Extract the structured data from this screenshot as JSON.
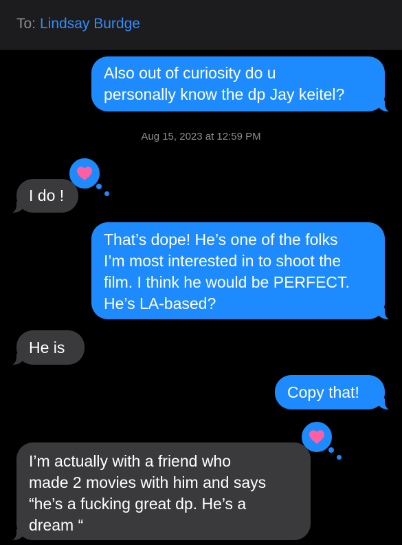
{
  "header": {
    "to_label": "To:",
    "recipient": "Lindsay Burdge"
  },
  "thread": {
    "messages": [
      {
        "direction": "sent",
        "text": "Also out of curiosity do u\npersonally know the dp Jay keitel?"
      },
      {
        "direction": "received",
        "text": "I do !",
        "reaction": "heart"
      },
      {
        "direction": "sent",
        "text": "That’s dope! He’s one of the folks\nI’m most interested in to shoot the\nfilm. I think he would be PERFECT.\nHe’s LA-based?"
      },
      {
        "direction": "received",
        "text": "He is"
      },
      {
        "direction": "sent",
        "text": "Copy that!"
      },
      {
        "direction": "received",
        "text": "I’m actually with a friend who\nmade 2 movies with him and  says\n“he’s a fucking great dp. He’s a\ndream “",
        "reaction": "heart"
      }
    ],
    "timestamp": "Aug 15, 2023 at 12:59 PM"
  },
  "colors": {
    "sent_bubble": "#1d8bfd",
    "received_bubble": "#3a3a3c",
    "reaction_heart": "#ff5fa2",
    "link": "#2f8cff",
    "secondary_text": "#8e8e93"
  },
  "icons": {
    "reaction": "heart-icon"
  }
}
